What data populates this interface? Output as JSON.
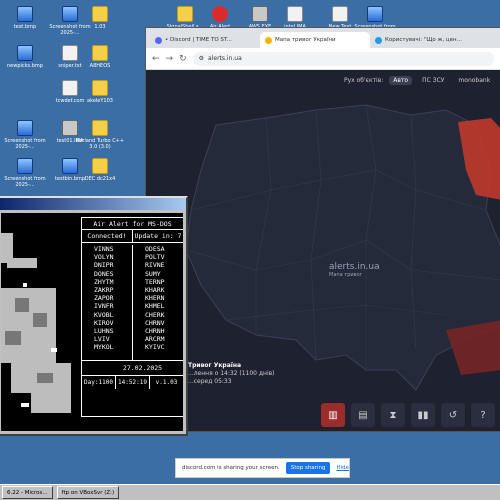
{
  "desktop_icons": [
    {
      "label": "test.bmp",
      "kind": "bmp"
    },
    {
      "label": "Screenshot from 2025-...",
      "kind": "bmp"
    },
    {
      "label": "1.03",
      "kind": "folder"
    },
    {
      "label": "SignalShell.s...",
      "kind": "folder"
    },
    {
      "label": "Air Alert",
      "kind": "red"
    },
    {
      "label": "AWS.EXE",
      "kind": "app"
    },
    {
      "label": "intel.IMA",
      "kind": "file"
    },
    {
      "label": "New Text Document",
      "kind": "file"
    },
    {
      "label": "Screenshot from 2025-...",
      "kind": "bmp"
    },
    {
      "label": "newpicks.bmp",
      "kind": "bmp"
    },
    {
      "label": "sniper.txt",
      "kind": "file"
    },
    {
      "label": "A8HEOS",
      "kind": "folder"
    },
    {
      "label": "tcwdef.com",
      "kind": "file"
    },
    {
      "label": "akeleY103",
      "kind": "folder"
    },
    {
      "label": "Screenshot from 2025-...",
      "kind": "bmp"
    },
    {
      "label": "test01.IMA",
      "kind": "app"
    },
    {
      "label": "Borland Turbo C++ 3.0 (3.0)",
      "kind": "folder"
    },
    {
      "label": "Screenshot from 2025-...",
      "kind": "bmp"
    },
    {
      "label": "testbin.bmp",
      "kind": "bmp"
    },
    {
      "label": "DEC dc21x4",
      "kind": "folder"
    }
  ],
  "browser": {
    "tabs": [
      {
        "label": "• Discord | TIME TO ST...",
        "fav_color": "#5865f2"
      },
      {
        "label": "Мапа тривог України",
        "fav_color": "#f4b400"
      },
      {
        "label": "Користувачі: \"Що ж, цен...",
        "fav_color": "#1d9bf0"
      }
    ],
    "url": "alerts.in.ua",
    "legend": {
      "label": "Рух об'єктів:",
      "items": [
        "Авто",
        "ПС ЗСУ",
        "monobank"
      ]
    },
    "watermark": "alerts.in.ua",
    "watermark_sub": "Мапа тривог",
    "info_title": "Тривог Україна",
    "info_line1": "...лення о 14:32 (1100 днів)",
    "info_line2": "...серед 05:33",
    "tools": [
      "▥",
      "▤",
      "⧗",
      "▮▮",
      "↺",
      "?"
    ]
  },
  "dos": {
    "title": "Air Alert for MS-DOS",
    "connected": "Connected!",
    "update": "Update in: 7",
    "regions_left": [
      "VINNS",
      "VOLYN",
      "DNIPR",
      "DONES",
      "ZHYTM",
      "ZAKRP",
      "ZAPOR",
      "IVNFR",
      "KVOBL",
      "KIROV",
      "LUHNS",
      "LVIV",
      "MYKOL"
    ],
    "regions_right": [
      "ODESA",
      "POLTV",
      "RIVNE",
      "SUMY",
      "TERNP",
      "KHARK",
      "KHERN",
      "KHMEL",
      "CHERK",
      "CHRNV",
      "CHRNH",
      "ARCRM",
      "KYIVC"
    ],
    "date": "27.02.2025",
    "day": "Day:1100",
    "time": "14:52:19",
    "version": "v.1.03"
  },
  "share": {
    "text": "discord.com is sharing your screen.",
    "stop": "Stop sharing",
    "hide": "Hide"
  },
  "taskbar": [
    "6.22 - Micros...",
    "ftp on VBoxSvr (Z:)"
  ]
}
